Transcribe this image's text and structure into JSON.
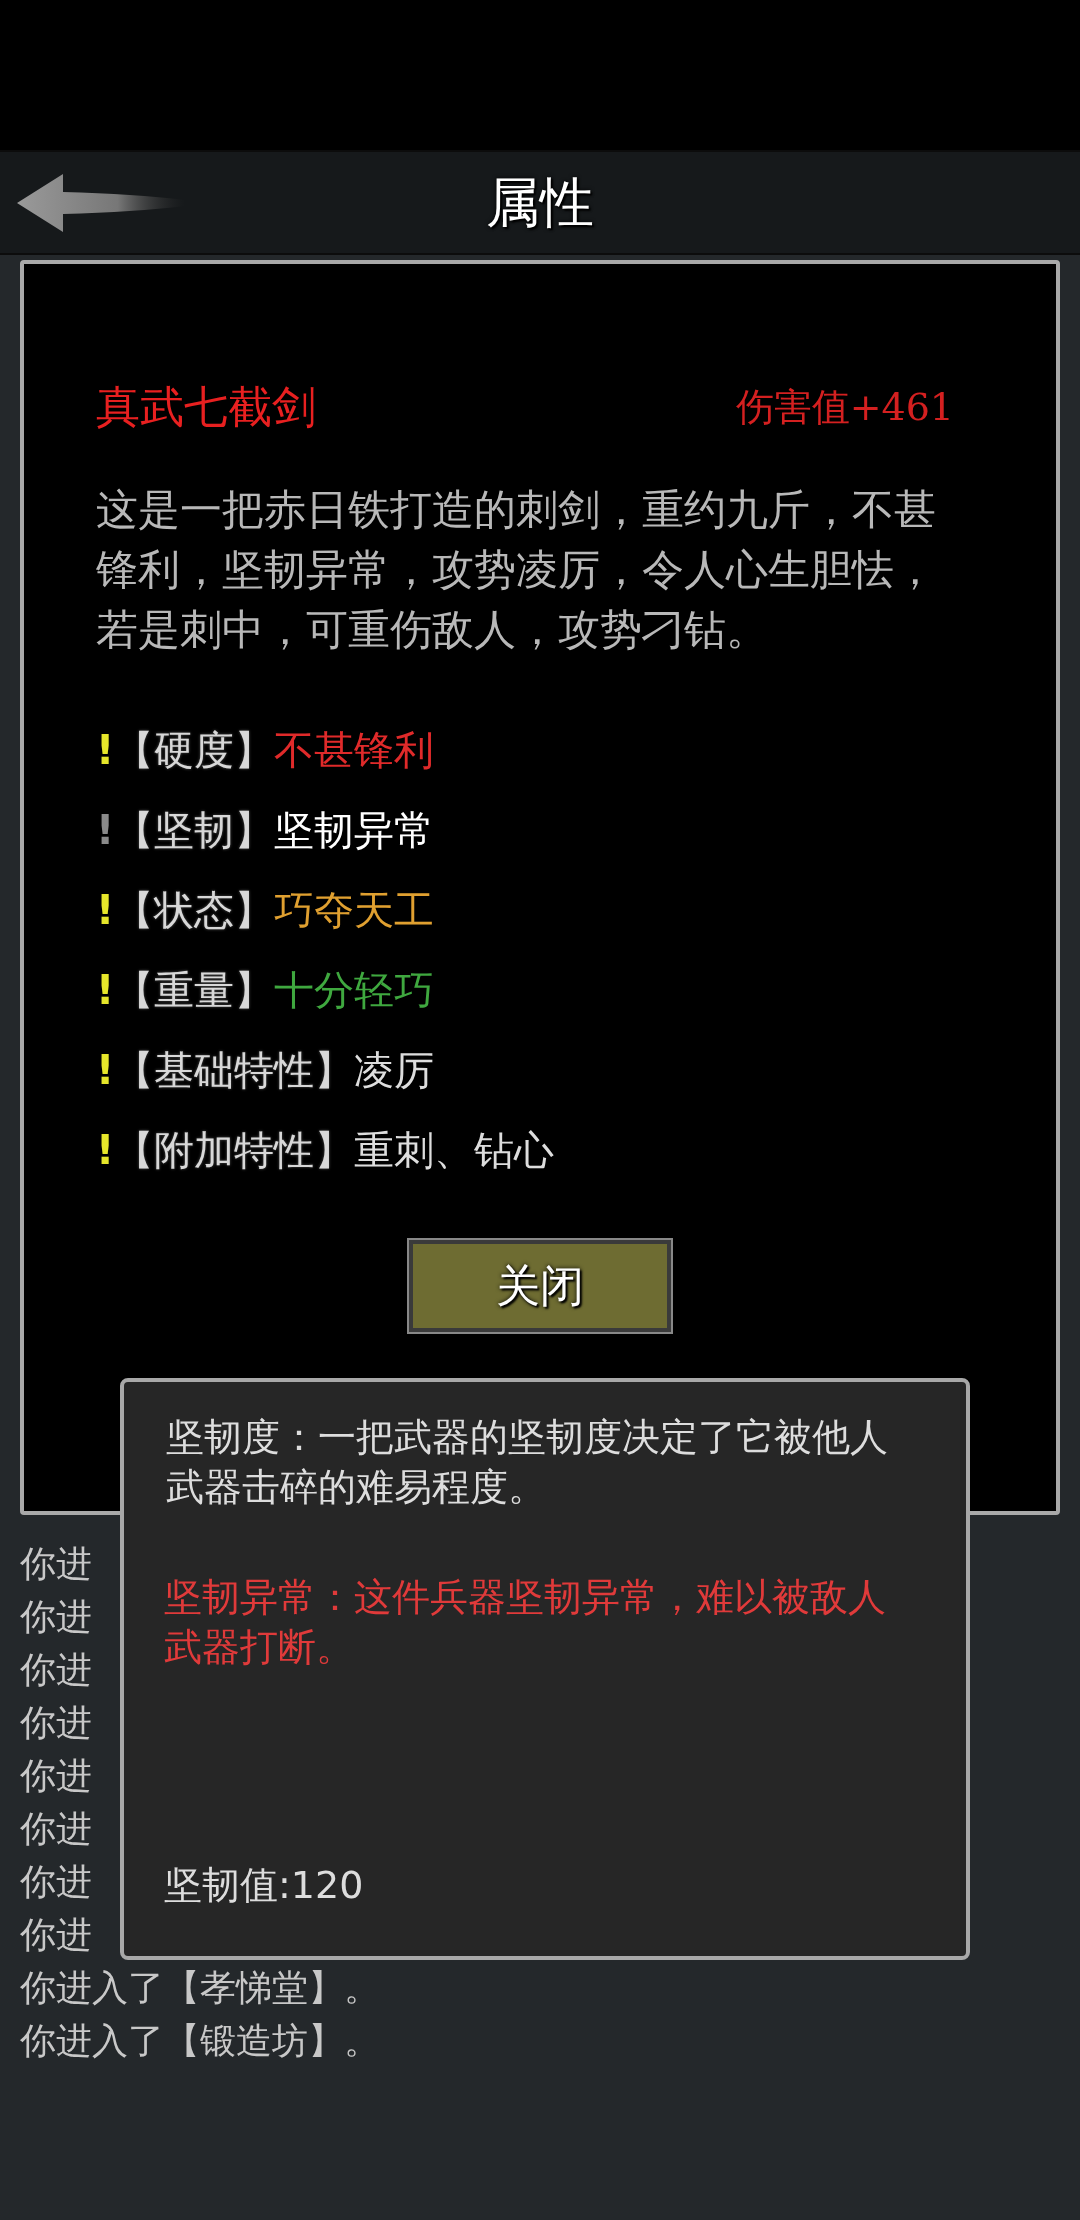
{
  "header": {
    "title": "属性"
  },
  "item": {
    "name": "真武七截剑",
    "damage_label": "伤害值+",
    "damage_value": "461",
    "description": "这是一把赤日铁打造的刺剑，重约九斤，不甚锋利，坚韧异常，攻势凌厉，令人心生胆怯，若是刺中，可重伤敌人，攻势刁钻。"
  },
  "attributes": [
    {
      "mark": "!",
      "label": "【硬度】",
      "value": "不甚锋利",
      "color": "#e02a2a",
      "selected": false
    },
    {
      "mark": "!",
      "label": "【坚韧】",
      "value": "坚韧异常",
      "color": "#ffffff",
      "selected": true
    },
    {
      "mark": "!",
      "label": "【状态】",
      "value": "巧夺天工",
      "color": "#e0a030",
      "selected": false
    },
    {
      "mark": "!",
      "label": "【重量】",
      "value": "十分轻巧",
      "color": "#3fa83f",
      "selected": false
    },
    {
      "mark": "!",
      "label": "【基础特性】",
      "value": "凌厉",
      "color": "#dddddd",
      "selected": false
    },
    {
      "mark": "!",
      "label": "【附加特性】",
      "value": "重刺、钻心",
      "color": "#dddddd",
      "selected": false
    }
  ],
  "close_button": "关闭",
  "log": [
    "你进",
    "你进",
    "你进",
    "你进",
    "你进",
    "你进",
    "你进",
    "你进",
    "你进入了【孝悌堂】。",
    "你进入了【锻造坊】。"
  ],
  "popup": {
    "definition": "坚韧度：一把武器的坚韧度决定了它被他人武器击碎的难易程度。",
    "effect": "坚韧异常：这件兵器坚韧异常，难以被敌人武器打断。",
    "stat": "坚韧值:120"
  }
}
